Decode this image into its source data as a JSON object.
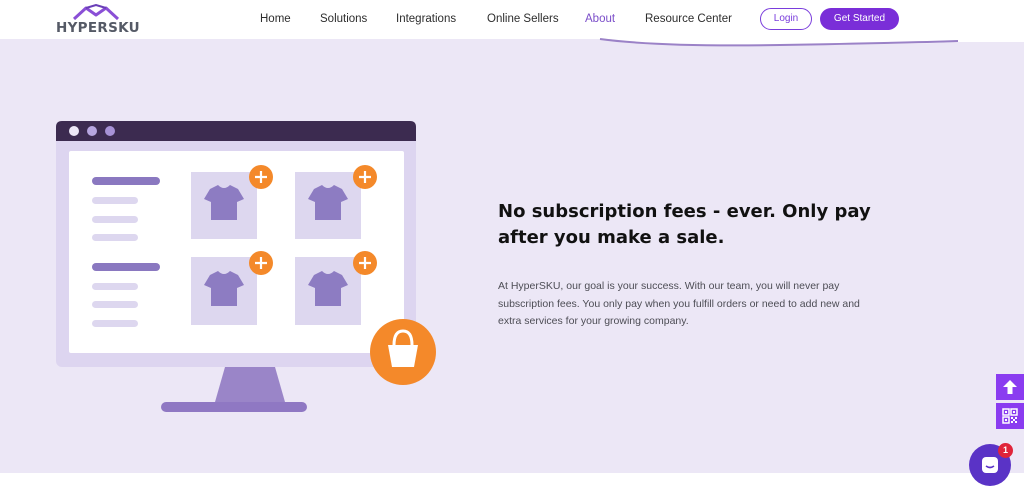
{
  "brand": {
    "name": "HYPERSKU",
    "logo_icon": "house-roof-icon",
    "color_primary": "#7a2ed8",
    "color_band": "#ece7f6"
  },
  "nav": {
    "items": [
      {
        "label": "Home"
      },
      {
        "label": "Solutions"
      },
      {
        "label": "Integrations"
      },
      {
        "label": "Online Sellers"
      },
      {
        "label": "About"
      },
      {
        "label": "Resource Center"
      }
    ],
    "active": "About",
    "login_label": "Login",
    "get_started_label": "Get Started"
  },
  "hero": {
    "headline_line1": "No subscription fees - ever. Only pay",
    "headline_line2": "after you make a sale.",
    "body_line1": "At HyperSKU, our goal is your success. With our team, you will never pay",
    "body_line2": "subscription fees. You only pay when you fulfill orders or need to add new and",
    "body_line3": "extra services for your growing company.",
    "illustration_icons": [
      "monitor-illustration",
      "tshirt-icon",
      "plus-icon",
      "shopping-bag-icon"
    ]
  },
  "widgets": {
    "scroll_top_icon": "arrow-up-icon",
    "qr_icon": "qr-code-icon",
    "chat_icon": "chat-icon",
    "chat_badge": "1"
  }
}
